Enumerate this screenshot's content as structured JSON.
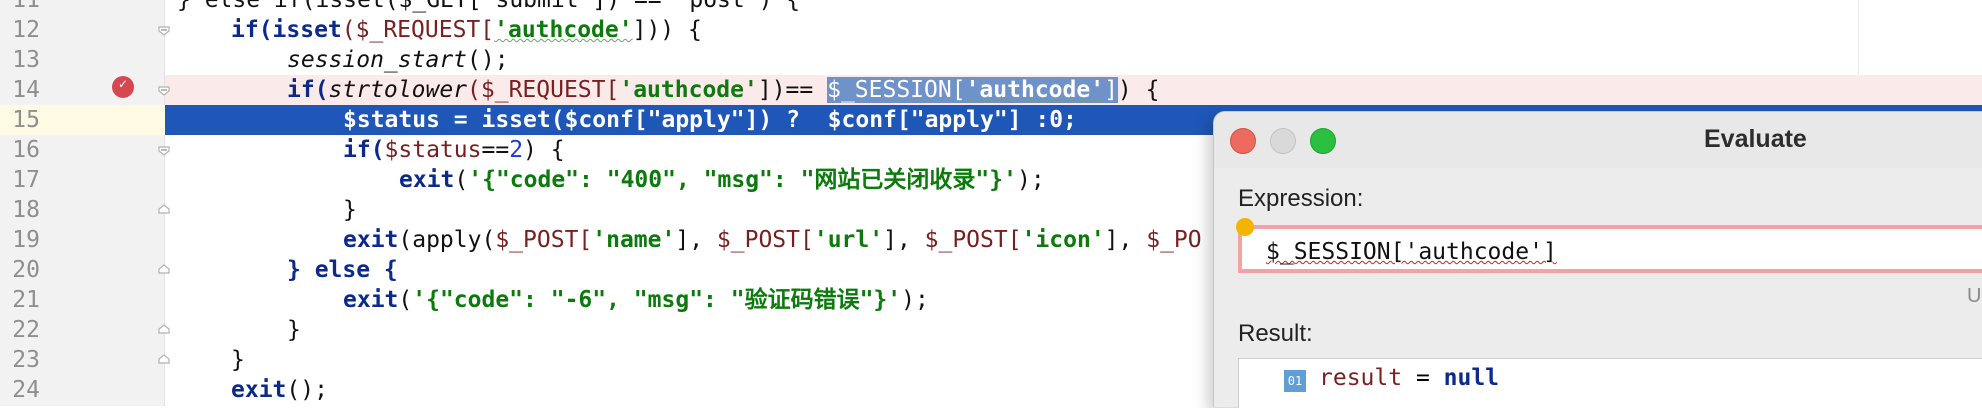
{
  "editor": {
    "lines": [
      {
        "num": "11",
        "text": "} else if(isset($_GET['submit']) == 'post') {"
      },
      {
        "num": "12"
      },
      {
        "num": "13"
      },
      {
        "num": "14"
      },
      {
        "num": "15"
      },
      {
        "num": "16"
      },
      {
        "num": "17"
      },
      {
        "num": "18"
      },
      {
        "num": "19"
      },
      {
        "num": "20"
      },
      {
        "num": "21"
      },
      {
        "num": "22"
      },
      {
        "num": "23"
      },
      {
        "num": "24"
      }
    ],
    "tokens": {
      "l12_if": "if(",
      "l12_isset": "isset",
      "l12_req": "($_REQUEST[",
      "l12_str": "'authcode'",
      "l12_end": "])) {",
      "l13_fn": "session_start",
      "l13_end": "();",
      "l14_if": "if(",
      "l14_fn": "strtolower",
      "l14_req": "($_REQUEST[",
      "l14_str": "'authcode'",
      "l14_mid": "])== ",
      "l14_sess": "$_SESSION[",
      "l14_sess_str": "'authcode'",
      "l14_sess_end": "]",
      "l14_end": ") {",
      "l15_text": "$status = isset($conf[\"apply\"]) ?  $conf[\"apply\"] :0;",
      "l16_if": "if(",
      "l16_var": "$status",
      "l16_op": "==",
      "l16_num": "2",
      "l16_end": ") {",
      "l17_exit": "exit",
      "l17_open": "(",
      "l17_str": "'{\"code\": \"400\", \"msg\": \"网站已关闭收录\"}'",
      "l17_end": ");",
      "l18_text": "}",
      "l19_exit": "exit",
      "l19_apply": "(apply(",
      "l19_post1": "$_POST[",
      "l19_s1": "'name'",
      "l19_c1": "], ",
      "l19_post2": "$_POST[",
      "l19_s2": "'url'",
      "l19_c2": "], ",
      "l19_post3": "$_POST[",
      "l19_s3": "'icon'",
      "l19_c3": "], ",
      "l19_post4": "$_PO",
      "l20_text": "} else {",
      "l21_exit": "exit",
      "l21_open": "(",
      "l21_str": "'{\"code\": \"-6\", \"msg\": \"验证码错误\"}'",
      "l21_end": ");",
      "l22_text": "}",
      "l23_text": "}",
      "l24_exit": "exit",
      "l24_end": "();"
    }
  },
  "dialog": {
    "title": "Evaluate",
    "expression_label": "Expression:",
    "expression_value": "$_SESSION['authcode']",
    "hint": "U",
    "result_label": "Result:",
    "result_icon": "01",
    "result_name": "result",
    "result_eq": " = ",
    "result_value": "null"
  },
  "colors": {
    "selection": "#1f57b8",
    "breakpoint": "#d7474f",
    "string": "#0d7a0d",
    "keyword": "#0b2a8c"
  }
}
